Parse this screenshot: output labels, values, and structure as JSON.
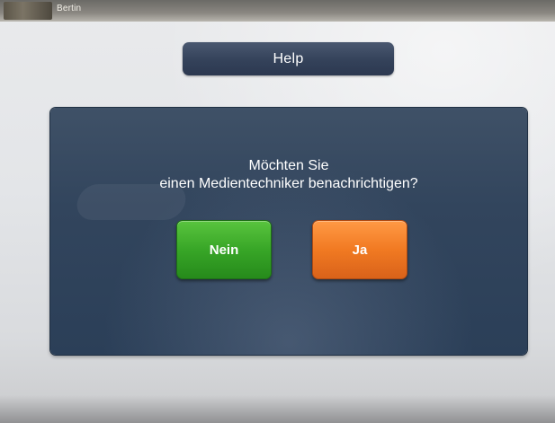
{
  "topbar": {
    "user_name": "Bertin"
  },
  "header": {
    "title": "Help"
  },
  "dialog": {
    "question_line1": "Möchten Sie",
    "question_line2": "einen Medientechniker benachrichtigen?",
    "no_label": "Nein",
    "yes_label": "Ja"
  },
  "colors": {
    "panel": "#32455d",
    "help_bar": "#34425a",
    "no_button": "#38a627",
    "yes_button": "#f17a22"
  }
}
